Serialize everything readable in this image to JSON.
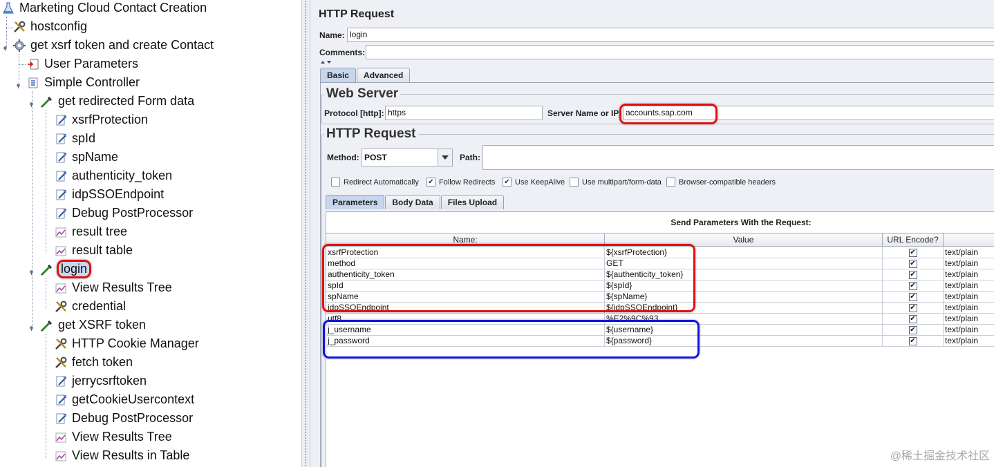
{
  "tree": {
    "nodes": [
      {
        "label": "Marketing Cloud Contact Creation",
        "icon": "flask-icon"
      },
      {
        "label": "hostconfig",
        "icon": "wrench-icon"
      },
      {
        "label": "get xsrf token and create Contact",
        "icon": "gear-icon"
      },
      {
        "label": "User Parameters",
        "icon": "preprocessor-icon"
      },
      {
        "label": "Simple Controller",
        "icon": "controller-icon"
      },
      {
        "label": "get redirected Form data",
        "icon": "pipette-icon"
      },
      {
        "label": "xsrfProtection",
        "icon": "extractor-icon"
      },
      {
        "label": "spId",
        "icon": "extractor-icon"
      },
      {
        "label": "spName",
        "icon": "extractor-icon"
      },
      {
        "label": "authenticity_token",
        "icon": "extractor-icon"
      },
      {
        "label": "idpSSOEndpoint",
        "icon": "extractor-icon"
      },
      {
        "label": "Debug PostProcessor",
        "icon": "extractor-icon"
      },
      {
        "label": "result tree",
        "icon": "chart-icon"
      },
      {
        "label": "result table",
        "icon": "chart-icon"
      },
      {
        "label": "login",
        "icon": "pipette-icon"
      },
      {
        "label": "View Results Tree",
        "icon": "chart-icon"
      },
      {
        "label": "credential",
        "icon": "wrench-icon"
      },
      {
        "label": "get XSRF token",
        "icon": "pipette-icon"
      },
      {
        "label": "HTTP Cookie Manager",
        "icon": "wrench-icon"
      },
      {
        "label": "fetch token",
        "icon": "wrench-icon"
      },
      {
        "label": "jerrycsrftoken",
        "icon": "extractor-icon"
      },
      {
        "label": "getCookieUsercontext",
        "icon": "extractor-icon"
      },
      {
        "label": "Debug PostProcessor",
        "icon": "extractor-icon"
      },
      {
        "label": "View Results Tree",
        "icon": "chart-icon"
      },
      {
        "label": "View Results in Table",
        "icon": "chart-icon"
      }
    ]
  },
  "panel": {
    "title": "HTTP Request",
    "name_label": "Name:",
    "name_value": "login",
    "comments_label": "Comments:",
    "tabs": [
      "Basic",
      "Advanced"
    ],
    "web_server": {
      "title": "Web Server",
      "protocol_label": "Protocol [http]:",
      "protocol_value": "https",
      "server_label": "Server Name or IP:",
      "server_value": "accounts.sap.com"
    },
    "http_request": {
      "title": "HTTP Request",
      "method_label": "Method:",
      "method_value": "POST",
      "path_label": "Path:",
      "checkboxes": [
        {
          "label": "Redirect Automatically",
          "checked": false
        },
        {
          "label": "Follow Redirects",
          "checked": true
        },
        {
          "label": "Use KeepAlive",
          "checked": true
        },
        {
          "label": "Use multipart/form-data",
          "checked": false
        },
        {
          "label": "Browser-compatible headers",
          "checked": false
        }
      ],
      "check_mark": "✔"
    },
    "sub_tabs": [
      "Parameters",
      "Body Data",
      "Files Upload"
    ],
    "table": {
      "caption": "Send Parameters With the Request:",
      "headers": [
        "Name:",
        "Value",
        "URL Encode?",
        ""
      ],
      "rows": [
        {
          "name": "xsrfProtection",
          "value": "${xsrfProtection}",
          "encode": true,
          "type": "text/plain"
        },
        {
          "name": "method",
          "value": "GET",
          "encode": true,
          "type": "text/plain"
        },
        {
          "name": "authenticity_token",
          "value": "${authenticity_token}",
          "encode": true,
          "type": "text/plain"
        },
        {
          "name": "spId",
          "value": "${spId}",
          "encode": true,
          "type": "text/plain"
        },
        {
          "name": "spName",
          "value": "${spName}",
          "encode": true,
          "type": "text/plain"
        },
        {
          "name": "idpSSOEndpoint",
          "value": "${idpSSOEndpoint}",
          "encode": true,
          "type": "text/plain"
        },
        {
          "name": "utf8",
          "value": "%E2%9C%93",
          "encode": true,
          "type": "text/plain"
        },
        {
          "name": "j_username",
          "value": "${username}",
          "encode": true,
          "type": "text/plain"
        },
        {
          "name": "j_password",
          "value": "${password}",
          "encode": true,
          "type": "text/plain"
        }
      ]
    }
  },
  "watermark": "@稀土掘金技术社区",
  "colors": {
    "highlight_red": "#e01010",
    "highlight_blue": "#1414e0",
    "selection": "#c9d7ee"
  }
}
